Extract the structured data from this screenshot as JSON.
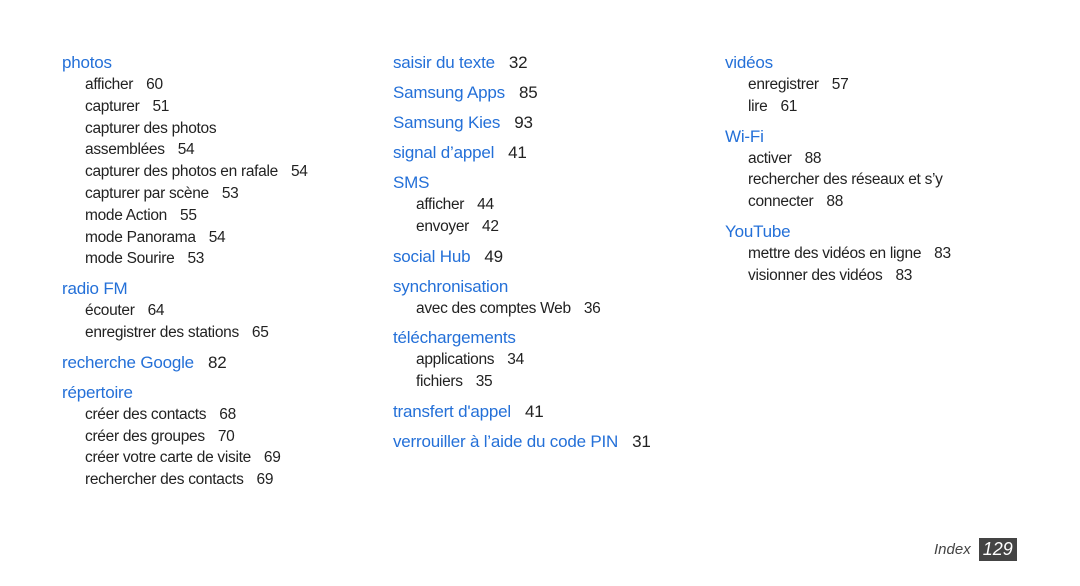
{
  "columns": [
    {
      "entries": [
        {
          "heading": "photos",
          "page": "",
          "subs": [
            {
              "text": "afficher",
              "page": "60"
            },
            {
              "text": "capturer",
              "page": "51"
            },
            {
              "text": "capturer des photos",
              "page": ""
            },
            {
              "text": "assemblées",
              "page": "54"
            },
            {
              "text": "capturer des photos en rafale",
              "page": "54"
            },
            {
              "text": "capturer par scène",
              "page": "53"
            },
            {
              "text": "mode Action",
              "page": "55"
            },
            {
              "text": "mode Panorama",
              "page": "54"
            },
            {
              "text": "mode Sourire",
              "page": "53"
            }
          ]
        },
        {
          "heading": "radio FM",
          "page": "",
          "subs": [
            {
              "text": "écouter",
              "page": "64"
            },
            {
              "text": "enregistrer des stations",
              "page": "65"
            }
          ]
        },
        {
          "heading": "recherche Google",
          "page": "82",
          "subs": []
        },
        {
          "heading": "répertoire",
          "page": "",
          "subs": [
            {
              "text": "créer des contacts",
              "page": "68"
            },
            {
              "text": "créer des groupes",
              "page": "70"
            },
            {
              "text": "créer votre carte de visite",
              "page": "69"
            },
            {
              "text": "rechercher des contacts",
              "page": "69"
            }
          ]
        }
      ]
    },
    {
      "entries": [
        {
          "heading": "saisir du texte",
          "page": "32",
          "subs": []
        },
        {
          "heading": "Samsung Apps",
          "page": "85",
          "subs": []
        },
        {
          "heading": "Samsung Kies",
          "page": "93",
          "subs": []
        },
        {
          "heading": "signal d’appel",
          "page": "41",
          "subs": []
        },
        {
          "heading": "SMS",
          "page": "",
          "subs": [
            {
              "text": "afficher",
              "page": "44"
            },
            {
              "text": "envoyer",
              "page": "42"
            }
          ]
        },
        {
          "heading": "social Hub",
          "page": "49",
          "subs": []
        },
        {
          "heading": "synchronisation",
          "page": "",
          "subs": [
            {
              "text": "avec des comptes Web",
              "page": "36"
            }
          ]
        },
        {
          "heading": "téléchargements",
          "page": "",
          "subs": [
            {
              "text": "applications",
              "page": "34"
            },
            {
              "text": "fichiers",
              "page": "35"
            }
          ]
        },
        {
          "heading": "transfert d'appel",
          "page": "41",
          "subs": []
        },
        {
          "heading": "verrouiller à l’aide du code PIN",
          "page": "31",
          "subs": []
        }
      ]
    },
    {
      "entries": [
        {
          "heading": "vidéos",
          "page": "",
          "subs": [
            {
              "text": "enregistrer",
              "page": "57"
            },
            {
              "text": "lire",
              "page": "61"
            }
          ]
        },
        {
          "heading": "Wi-Fi",
          "page": "",
          "subs": [
            {
              "text": "activer",
              "page": "88"
            },
            {
              "text": "rechercher des réseaux et s’y",
              "page": ""
            },
            {
              "text": "connecter",
              "page": "88"
            }
          ]
        },
        {
          "heading": "YouTube",
          "page": "",
          "subs": [
            {
              "text": "mettre des vidéos en ligne",
              "page": "83"
            },
            {
              "text": "visionner des vidéos",
              "page": "83"
            }
          ]
        }
      ]
    }
  ],
  "footer": {
    "label": "Index",
    "page_number": "129"
  },
  "colors": {
    "heading": "#2470d8",
    "text": "#222222",
    "page_box": "#444444"
  }
}
